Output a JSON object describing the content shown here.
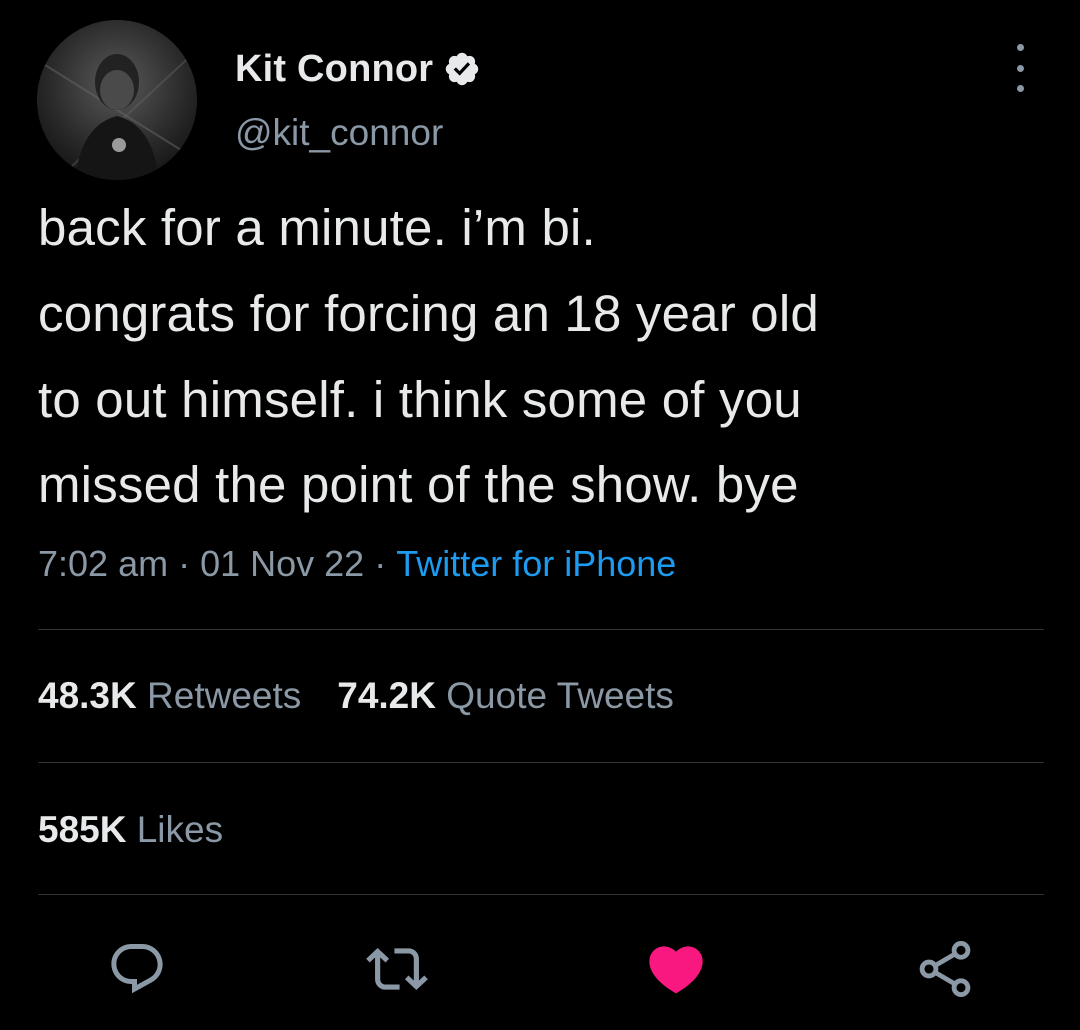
{
  "user": {
    "display_name": "Kit Connor",
    "handle": "@kit_connor",
    "verified": true
  },
  "tweet": {
    "lines": [
      "back for a minute. i’m bi.",
      "congrats for forcing an 18 year old",
      "to out himself. i think some of you",
      "missed the point of the show. bye"
    ],
    "time": "7:02 am",
    "date": "01 Nov 22",
    "separator": "·",
    "source": "Twitter for iPhone"
  },
  "stats": {
    "retweets_count": "48.3K",
    "retweets_label": "Retweets",
    "quotes_count": "74.2K",
    "quotes_label": "Quote Tweets",
    "likes_count": "585K",
    "likes_label": "Likes"
  },
  "actions": [
    {
      "icon": "reply-icon"
    },
    {
      "icon": "retweet-icon"
    },
    {
      "icon": "like-heart-icon",
      "active": true
    },
    {
      "icon": "share-icon"
    }
  ],
  "colors": {
    "background": "#000000",
    "text": "#e7e9ea",
    "secondary": "#8b98a5",
    "link": "#1d9bf0",
    "like": "#f91880",
    "verified_badge": "#e7e9ea",
    "divider": "#2f3336"
  }
}
